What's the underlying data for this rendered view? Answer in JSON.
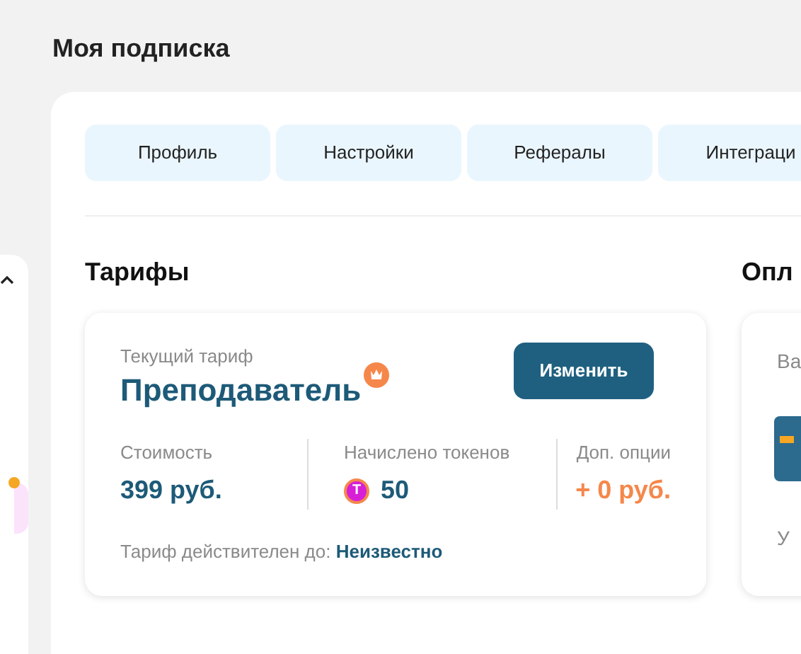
{
  "page_title": "Моя подписка",
  "tabs": [
    {
      "label": "Профиль",
      "selected": false
    },
    {
      "label": "Настройки",
      "selected": false
    },
    {
      "label": "Рефералы",
      "selected": false
    },
    {
      "label": "Интеграци",
      "selected": false
    }
  ],
  "tariffs": {
    "heading": "Тарифы",
    "label": "Текущий тариф",
    "plan": "Преподаватель",
    "button": "Изменить",
    "stats": [
      {
        "kind": "price",
        "label": "Стоимость",
        "value": "399 руб."
      },
      {
        "kind": "tokens",
        "label": "Начислено токенов",
        "value": "50",
        "icon_text": "T"
      },
      {
        "kind": "extra",
        "label": "Доп. опции",
        "value": "+ 0 руб."
      }
    ],
    "valid_label": "Тариф действителен до:",
    "valid_value": "Неизвестно"
  },
  "payment": {
    "heading": "Опл",
    "label": "Ва",
    "note": "У"
  }
}
